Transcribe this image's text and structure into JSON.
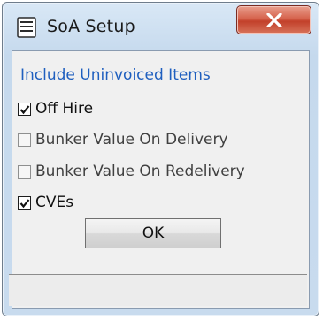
{
  "window": {
    "title": "SoA Setup",
    "icon": "document-list-icon",
    "close_icon": "close-x-icon"
  },
  "section": {
    "label": "Include Uninvoiced Items"
  },
  "options": [
    {
      "label": "Off Hire",
      "checked": true
    },
    {
      "label": "Bunker Value On Delivery",
      "checked": false
    },
    {
      "label": "Bunker Value On Redelivery",
      "checked": false
    },
    {
      "label": "CVEs",
      "checked": true
    }
  ],
  "buttons": {
    "ok_label": "OK"
  },
  "colors": {
    "section_label": "#1f5fbf",
    "close_button": "#c2402a",
    "window_frame": "#c5d9ed"
  }
}
